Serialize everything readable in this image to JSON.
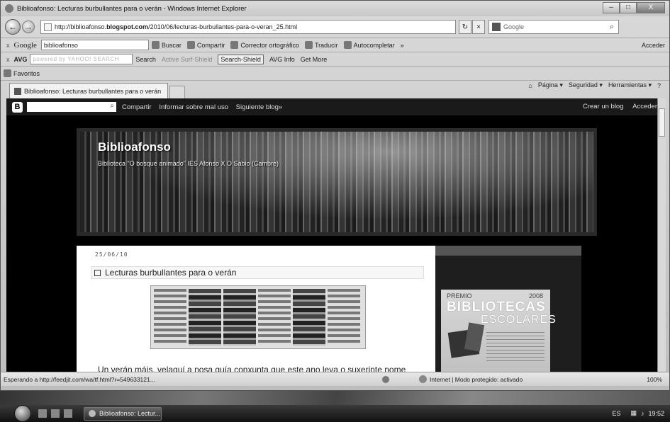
{
  "window": {
    "title": "Biblioafonso: Lecturas burbullantes para o verán - Windows Internet Explorer",
    "minimize": "–",
    "maximize": "□",
    "close": "X"
  },
  "address_bar": {
    "url_prefix": "http://biblioafonso.",
    "url_domain": "blogspot.com",
    "url_path": "/2010/06/lecturas-burbullantes-para-o-veran_25.html",
    "back_icon": "←",
    "forward_icon": "→",
    "search_placeholder": "Google",
    "refresh": "↻",
    "stop": "×",
    "search_icon": "⌕"
  },
  "google_toolbar": {
    "close": "x",
    "logo": "Google",
    "query": "biblioafonso",
    "buscar": "Buscar",
    "compartir": "Compartir",
    "corrector": "Corrector ortográfico",
    "traducir": "Traducir",
    "autocompletar": "Autocompletar",
    "more": "»",
    "acceder": "Acceder"
  },
  "avg_toolbar": {
    "close": "x",
    "logo": "AVG",
    "search_placeholder": "powered by YAHOO! SEARCH",
    "search": "Search",
    "active_surf": "Active Surf-Shield",
    "search_shield": "Search-Shield",
    "avg_info": "AVG Info",
    "get_more": "Get More"
  },
  "favorites_bar": {
    "favoritos": "Favoritos"
  },
  "tab": {
    "label": "Biblioafonso: Lecturas burbullantes para o verán"
  },
  "command_bar": {
    "pagina": "Página ▾",
    "seguridad": "Seguridad ▾",
    "herramientas": "Herramientas ▾",
    "help": "?"
  },
  "blogger_bar": {
    "logo": "B",
    "compartir": "Compartir",
    "informar": "Informar sobre mal uso",
    "siguiente": "Siguiente blog»",
    "crear": "Crear un blog",
    "acceder": "Acceder"
  },
  "blog": {
    "title": "Biblioafonso",
    "description": "Biblioteca \"O bosque animado\" IES Afonso X O Sabio (Cambre)"
  },
  "post": {
    "date": "25/06/10",
    "title": "Lecturas burbullantes para o verán",
    "text": "Un verán máis, velaquí a nosa guía conxunta que este ano leva o suxerinte nome"
  },
  "award": {
    "premio": "PREMIO",
    "year": "2008",
    "bibliotecas": "BIBLIOTECAS",
    "escolares": "ESCOLARES"
  },
  "status_bar": {
    "loading": "Esperando a http://feedjit.com/wa/tf.html?r=549633121...",
    "zone": "Internet | Modo protegido: activado",
    "zoom": "100%"
  },
  "taskbar": {
    "ie_button": "Biblioafonso: Lectur...",
    "lang": "ES",
    "clock": "19:52"
  },
  "colors": {
    "blog_background": "#000000",
    "post_background": "#ffffff"
  }
}
